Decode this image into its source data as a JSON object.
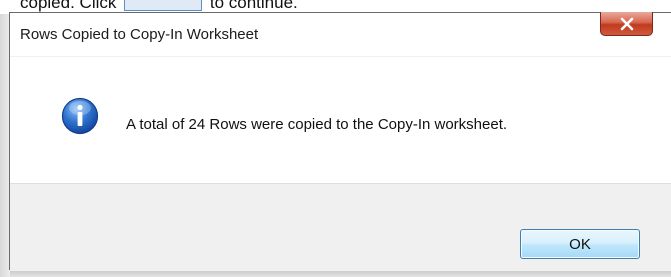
{
  "background": {
    "text_before": "copied. Click",
    "text_after": "to continue."
  },
  "dialog": {
    "title": "Rows Copied to Copy-In Worksheet",
    "close_icon": "close-icon",
    "info_icon": "info-icon",
    "message": "A total of 24 Rows were copied to the Copy-In worksheet.",
    "ok_label": "OK"
  },
  "colors": {
    "close_button": "#c94a2f",
    "ok_border": "#3c7fb1",
    "info_icon_blue": "#1f5fbf",
    "button_area": "#f0f0f0"
  }
}
